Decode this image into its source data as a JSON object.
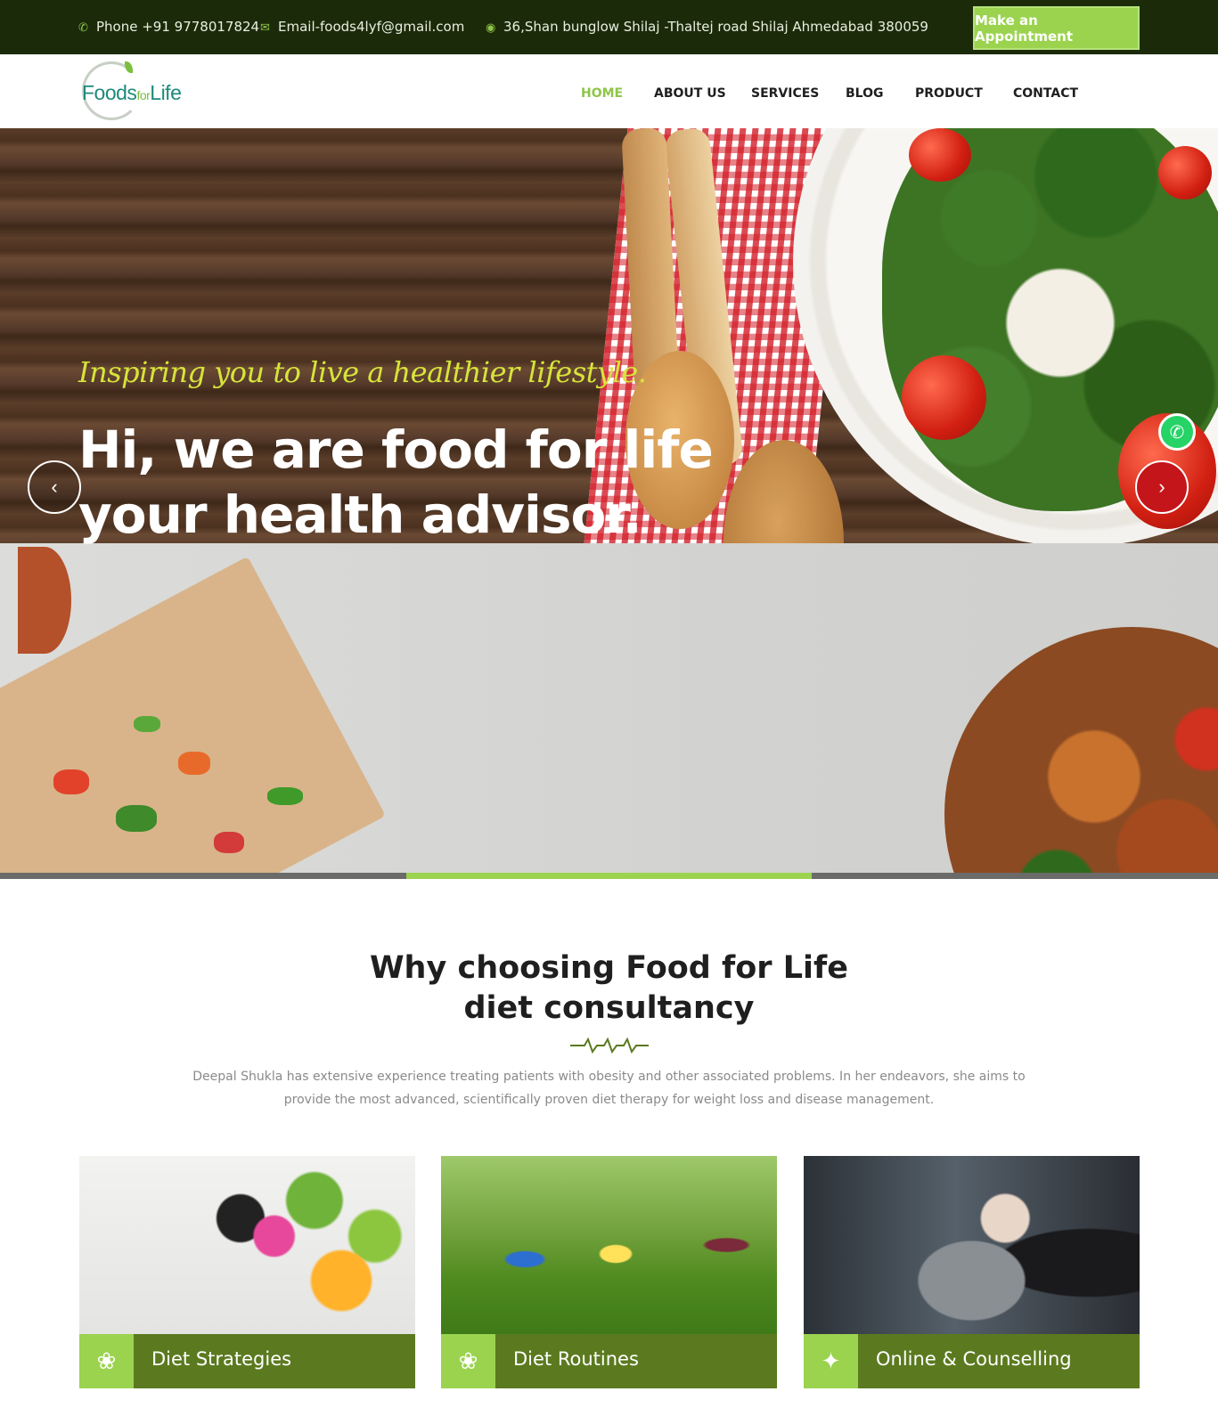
{
  "topbar": {
    "phone": "Phone +91 9778017824",
    "email": "Email-foods4lyf@gmail.com",
    "address": "36,Shan bunglow Shilaj -Thaltej road Shilaj Ahmedabad 380059",
    "appointment_label": "Make an Appointment",
    "icons": {
      "phone": "phone-icon",
      "email": "envelope-icon",
      "address": "globe-icon"
    }
  },
  "brand": {
    "logo_word1": "Foods",
    "logo_word2": "for",
    "logo_word3": "Life",
    "colors": {
      "primary_green": "#9bd34f",
      "dark_green": "#5b7a1f",
      "topbar": "#1b2b0a",
      "accent_red": "#c4151b"
    }
  },
  "nav": {
    "items": [
      "HOME",
      "ABOUT US",
      "SERVICES",
      "BLOG",
      "PRODUCT",
      "CONTACT"
    ],
    "active": "HOME"
  },
  "hero": {
    "kicker": "Inspiring you to live a healthier lifestyle.",
    "headline_line1": "Hi, we are food for life",
    "headline_line2": "your health advisor.",
    "prev_label": "‹",
    "next_label": "›",
    "slides_total": 3,
    "active_slide": 2
  },
  "why": {
    "title_line1": "Why choosing Food for Life",
    "title_line2": "diet consultancy",
    "description": "Deepal Shukla has extensive experience treating patients with obesity and other associated problems. In her endeavors, she aims to provide the most advanced, scientifically proven diet therapy for weight loss and disease management."
  },
  "cards": [
    {
      "title": "Diet Strategies",
      "icon": "pineapple-icon"
    },
    {
      "title": "Diet Routines",
      "icon": "pineapple-icon"
    },
    {
      "title": "Online & Counselling",
      "icon": "person-icon"
    }
  ]
}
